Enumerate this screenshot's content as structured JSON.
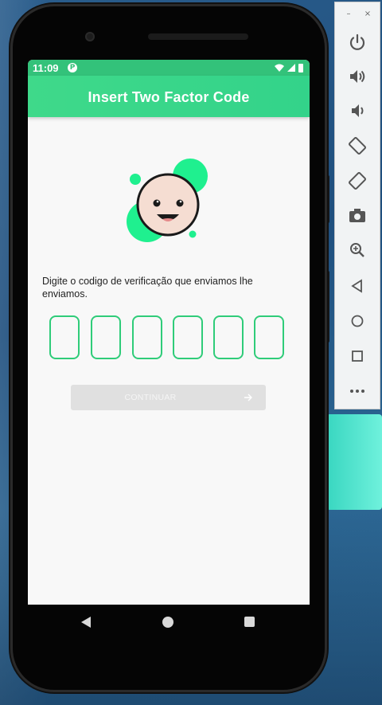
{
  "status_bar": {
    "time": "11:09",
    "app_icon_glyph": "P"
  },
  "app_bar": {
    "title": "Insert Two Factor Code"
  },
  "content": {
    "instruction": "Digite o codigo de verificação que enviamos lhe enviamos.",
    "code_boxes": [
      "",
      "",
      "",
      "",
      "",
      ""
    ],
    "continue_label": "CONTINUAR"
  },
  "emulator_toolbar": {
    "minimize": "–",
    "close": "×",
    "buttons": [
      "power-icon",
      "volume-up-icon",
      "volume-down-icon",
      "rotate-left-icon",
      "rotate-right-icon",
      "camera-icon",
      "zoom-icon",
      "back-icon",
      "home-icon",
      "overview-icon",
      "more-icon"
    ]
  },
  "colors": {
    "accent": "#33d38a",
    "code_border": "#2fcc79",
    "button_disabled": "#e0e0e0"
  }
}
